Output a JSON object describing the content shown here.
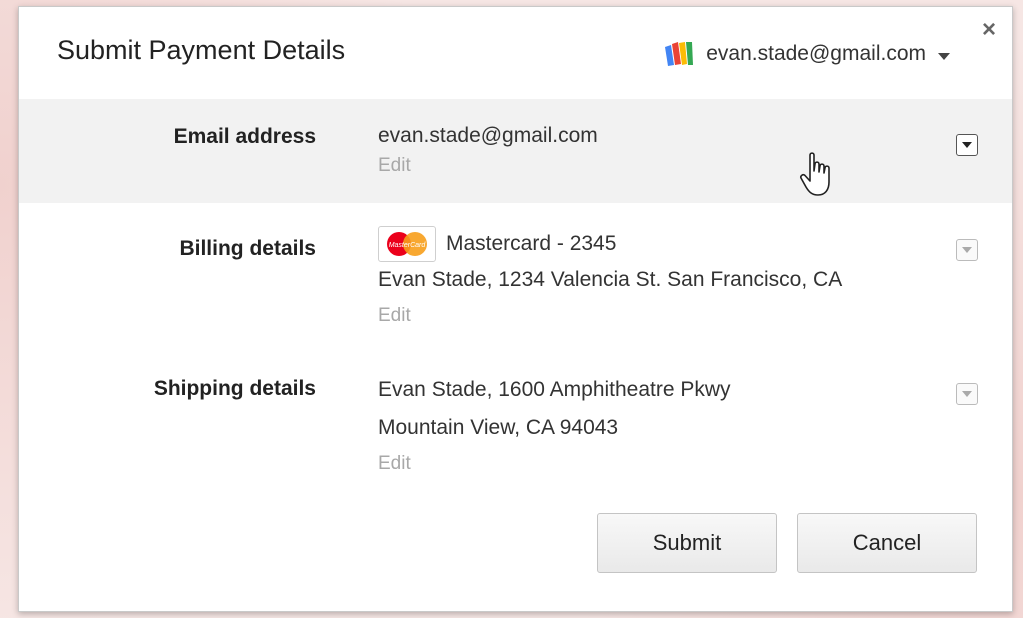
{
  "dialog": {
    "title": "Submit Payment Details",
    "account_email": "evan.stade@gmail.com",
    "close_label": "×"
  },
  "sections": {
    "email": {
      "label": "Email address",
      "value": "evan.stade@gmail.com",
      "edit": "Edit"
    },
    "billing": {
      "label": "Billing details",
      "card": "Mastercard - 2345",
      "card_brand": "MasterCard",
      "address": "Evan Stade, 1234 Valencia St. San Francisco, CA",
      "edit": "Edit"
    },
    "shipping": {
      "label": "Shipping details",
      "line1": "Evan Stade, 1600 Amphitheatre Pkwy",
      "line2": "Mountain View, CA 94043",
      "edit": "Edit"
    }
  },
  "buttons": {
    "submit": "Submit",
    "cancel": "Cancel"
  },
  "icons": [
    "wallet-icon",
    "chevron-down-icon",
    "close-icon",
    "mastercard-icon",
    "menu-dropdown-icon",
    "hand-cursor-icon"
  ],
  "colors": {
    "highlight_row": "#f2f2f2",
    "edit_link": "#a8a8a8",
    "mastercard_red": "#eb001b",
    "mastercard_orange": "#f79e1b"
  }
}
